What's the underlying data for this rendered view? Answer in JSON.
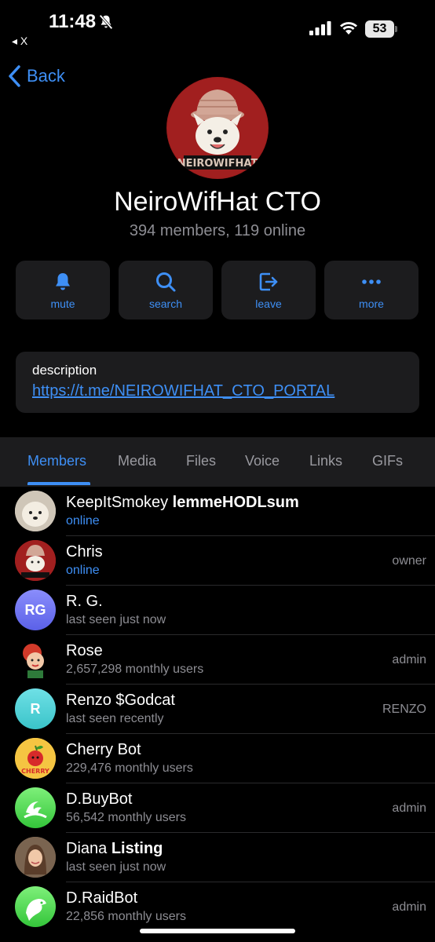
{
  "status_bar": {
    "time": "11:48",
    "back_app": "◂ X",
    "battery": "53"
  },
  "nav": {
    "back_label": "Back"
  },
  "group": {
    "title": "NeiroWifHat CTO",
    "subtitle": "394 members, 119 online",
    "avatar_text": "NEIROWIFHAT"
  },
  "actions": [
    {
      "label": "mute",
      "icon": "bell-icon"
    },
    {
      "label": "search",
      "icon": "search-icon"
    },
    {
      "label": "leave",
      "icon": "leave-icon"
    },
    {
      "label": "more",
      "icon": "more-icon"
    }
  ],
  "description": {
    "label": "description",
    "link": "https://t.me/NEIROWIFHAT_CTO_PORTAL"
  },
  "tabs": [
    "Members",
    "Media",
    "Files",
    "Voice",
    "Links",
    "GIFs"
  ],
  "active_tab": "Members",
  "members": [
    {
      "name": "KeepItSmokey",
      "name_bold": "lemmeHODLsum",
      "status": "online",
      "role": ""
    },
    {
      "name": "Chris",
      "name_bold": "",
      "status": "online",
      "role": "owner"
    },
    {
      "name": "R. G.",
      "name_bold": "",
      "status": "last seen just now",
      "role": "",
      "initials": "RG"
    },
    {
      "name": "Rose",
      "name_bold": "",
      "status": "2,657,298 monthly users",
      "role": "admin"
    },
    {
      "name": "Renzo $Godcat",
      "name_bold": "",
      "status": "last seen recently",
      "role": "RENZO",
      "initials": "R"
    },
    {
      "name": "Cherry Bot",
      "name_bold": "",
      "status": "229,476 monthly users",
      "role": "",
      "badge": "CHERRY"
    },
    {
      "name": "D.BuyBot",
      "name_bold": "",
      "status": "56,542 monthly users",
      "role": "admin"
    },
    {
      "name": "Diana",
      "name_bold": "Listing",
      "status": "last seen just now",
      "role": ""
    },
    {
      "name": "D.RaidBot",
      "name_bold": "",
      "status": "22,856 monthly users",
      "role": "admin"
    }
  ],
  "colors": {
    "accent": "#3e8ff5",
    "card": "#1c1c1e",
    "secondary_text": "#8d8d93"
  }
}
